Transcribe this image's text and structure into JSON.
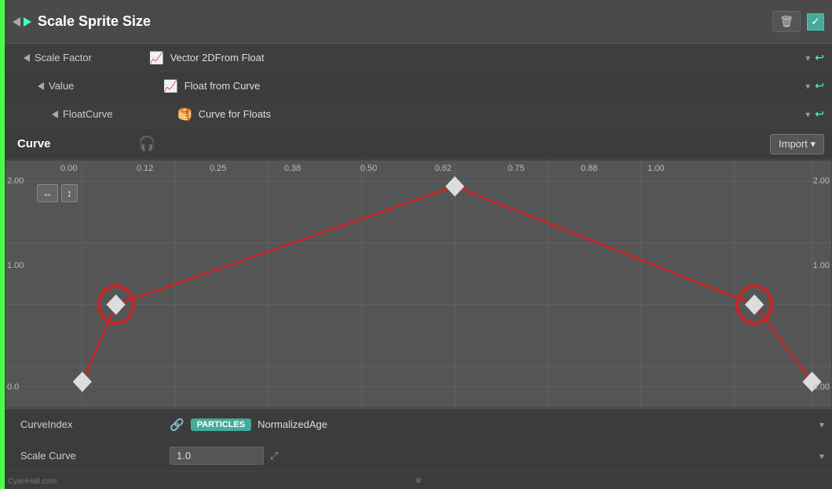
{
  "header": {
    "title": "Scale Sprite Size",
    "delete_label": "🗑",
    "check_label": "✓"
  },
  "properties": {
    "scale_factor": {
      "label": "Scale Factor",
      "type_label": "Vector 2DFrom Float"
    },
    "value": {
      "label": "Value",
      "type_label": "Float from Curve"
    },
    "float_curve": {
      "label": "FloatCurve",
      "type_label": "Curve for Floats"
    },
    "curve": {
      "label": "Curve"
    }
  },
  "curve_editor": {
    "x_labels": [
      "0.00",
      "0.12",
      "0.25",
      "0.38",
      "0.50",
      "0.62",
      "0.75",
      "0.88",
      "1.00"
    ],
    "y_label_top": "2.00",
    "y_label_mid": "1.00",
    "y_label_bot": "0.0",
    "y_label_right_top": "2.00",
    "y_label_right_mid": "1.00",
    "y_label_right_bot": "0.00",
    "fit_x_label": "↔",
    "fit_y_label": "↕",
    "import_btn": "Import ▾"
  },
  "bottom_props": {
    "curve_index_label": "CurveIndex",
    "curve_index_particles": "PARTICLES",
    "curve_index_value": "NormalizedAge",
    "scale_curve_label": "Scale Curve",
    "scale_curve_value": "1.0"
  },
  "watermark": "CyanHall.com"
}
